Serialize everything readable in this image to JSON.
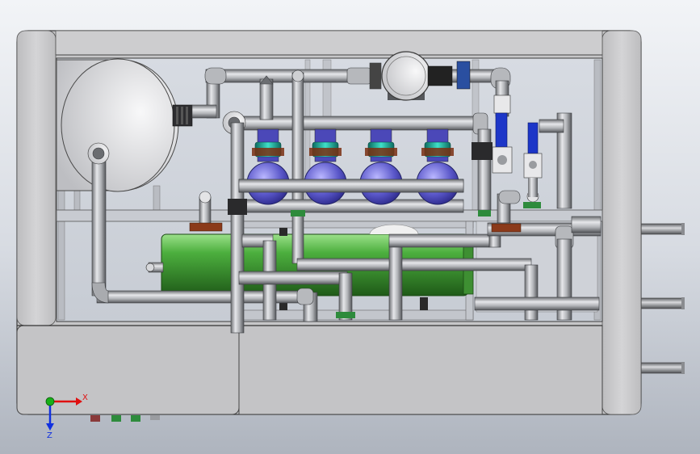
{
  "viewport": {
    "background_top": "#f2f4f7",
    "background_bottom": "#aeb4be"
  },
  "model": {
    "frame_color": "#c9c9cb",
    "frame_edge": "#4a4a4a",
    "interior_color": "#d3d7de",
    "pipe_color": "#a7a9ad",
    "tank_color": "#e2e2e4",
    "vessel_color": "#4caf3e",
    "pump_color": "#5a57c9",
    "collar_color": "#1aa895",
    "bracket_color": "#8b3a1a",
    "valve_handle_color": "#1d36c8",
    "clamp_color": "#2e8b3c"
  },
  "triad": {
    "x_label": "X",
    "z_label": "Z",
    "x_color": "#e01010",
    "y_color": "#18b018",
    "z_color": "#1030e0"
  }
}
